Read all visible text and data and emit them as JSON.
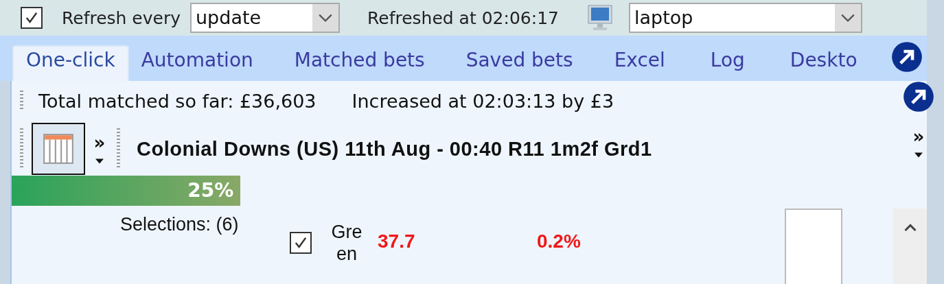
{
  "toolbar": {
    "refresh_checked": true,
    "refresh_label": "Refresh every",
    "refresh_value": "update",
    "refreshed_text": "Refreshed at 02:06:17",
    "profile_value": "laptop"
  },
  "tabs": [
    {
      "label": "One-click",
      "selected": true
    },
    {
      "label": "Automation",
      "selected": false
    },
    {
      "label": "Matched bets",
      "selected": false
    },
    {
      "label": "Saved bets",
      "selected": false
    },
    {
      "label": "Excel",
      "selected": false
    },
    {
      "label": "Log",
      "selected": false
    },
    {
      "label": "Deskto",
      "selected": false
    }
  ],
  "info": {
    "total_matched": "Total matched so far: £36,603",
    "increased": "Increased at 02:03:13 by £3"
  },
  "market": {
    "title": "Colonial Downs (US) 11th Aug - 00:40 R11 1m2f Grd1",
    "more_left": "»",
    "more_right": "»"
  },
  "progress": {
    "level": 0.25,
    "label": "25%"
  },
  "selections": {
    "label": "Selections: (6)",
    "checked": true,
    "name": "Gre en",
    "value_1": "37.7",
    "value_2": "0.2%"
  }
}
